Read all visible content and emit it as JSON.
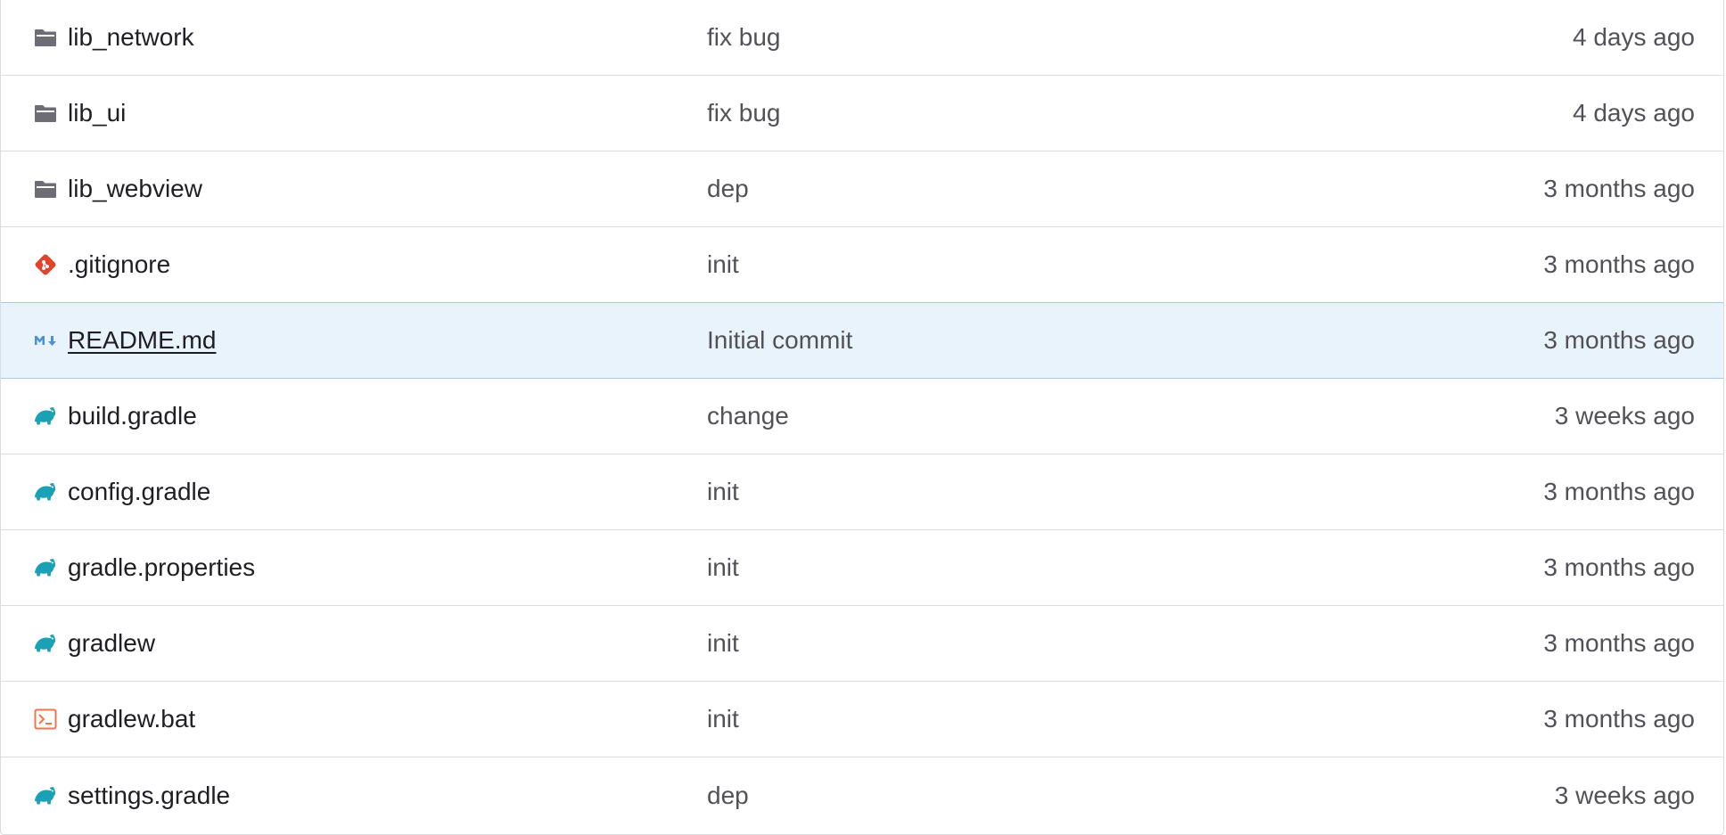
{
  "files": [
    {
      "name": "lib_network",
      "icon": "folder-icon",
      "commit": "fix bug",
      "time": "4 days ago"
    },
    {
      "name": "lib_ui",
      "icon": "folder-icon",
      "commit": "fix bug",
      "time": "4 days ago"
    },
    {
      "name": "lib_webview",
      "icon": "folder-icon",
      "commit": "dep",
      "time": "3 months ago"
    },
    {
      "name": ".gitignore",
      "icon": "git-icon",
      "commit": "init",
      "time": "3 months ago"
    },
    {
      "name": "README.md",
      "icon": "markdown-icon",
      "commit": "Initial commit",
      "time": "3 months ago"
    },
    {
      "name": "build.gradle",
      "icon": "gradle-icon",
      "commit": "change",
      "time": "3 weeks ago"
    },
    {
      "name": "config.gradle",
      "icon": "gradle-icon",
      "commit": "init",
      "time": "3 months ago"
    },
    {
      "name": "gradle.properties",
      "icon": "gradle-icon",
      "commit": "init",
      "time": "3 months ago"
    },
    {
      "name": "gradlew",
      "icon": "gradle-icon",
      "commit": "init",
      "time": "3 months ago"
    },
    {
      "name": "gradlew.bat",
      "icon": "terminal-icon",
      "commit": "init",
      "time": "3 months ago"
    },
    {
      "name": "settings.gradle",
      "icon": "gradle-icon",
      "commit": "dep",
      "time": "3 weeks ago"
    }
  ],
  "colors": {
    "folder": "#6e6c75",
    "git": "#e24329",
    "markdown": "#4a90d9",
    "gradle": "#1ba1b5",
    "terminal": "#f0754f",
    "highlight_row": "#e9f3fc"
  }
}
